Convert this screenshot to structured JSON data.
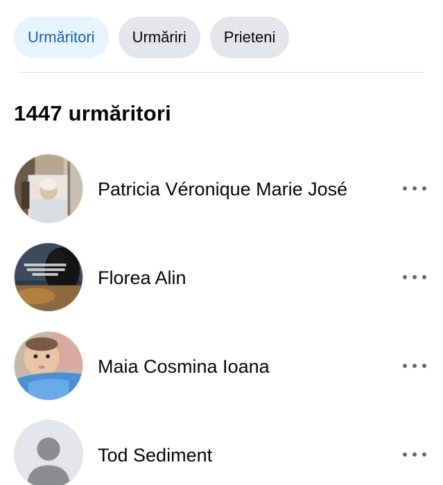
{
  "tabs": [
    {
      "label": "Urmăritori",
      "active": true
    },
    {
      "label": "Urmăriri",
      "active": false
    },
    {
      "label": "Prieteni",
      "active": false
    }
  ],
  "section": {
    "title": "1447 urmăritori"
  },
  "followers": [
    {
      "name": "Patricia Véronique Marie José",
      "avatar": "photo-elderly-woman-hospital"
    },
    {
      "name": "Florea Alin",
      "avatar": "photo-dog-with-text"
    },
    {
      "name": "Maia Cosmina Ioana",
      "avatar": "photo-baby"
    },
    {
      "name": "Tod Sediment",
      "avatar": "default-profile-silhouette"
    }
  ],
  "colors": {
    "active_tab_bg": "#e7f3ff",
    "active_tab_text": "#1b5fb3",
    "inactive_tab_bg": "#e4e6eb",
    "divider": "#dadde1",
    "more_dots": "#65676b"
  },
  "icons": {
    "more": "more-horizontal-icon"
  }
}
